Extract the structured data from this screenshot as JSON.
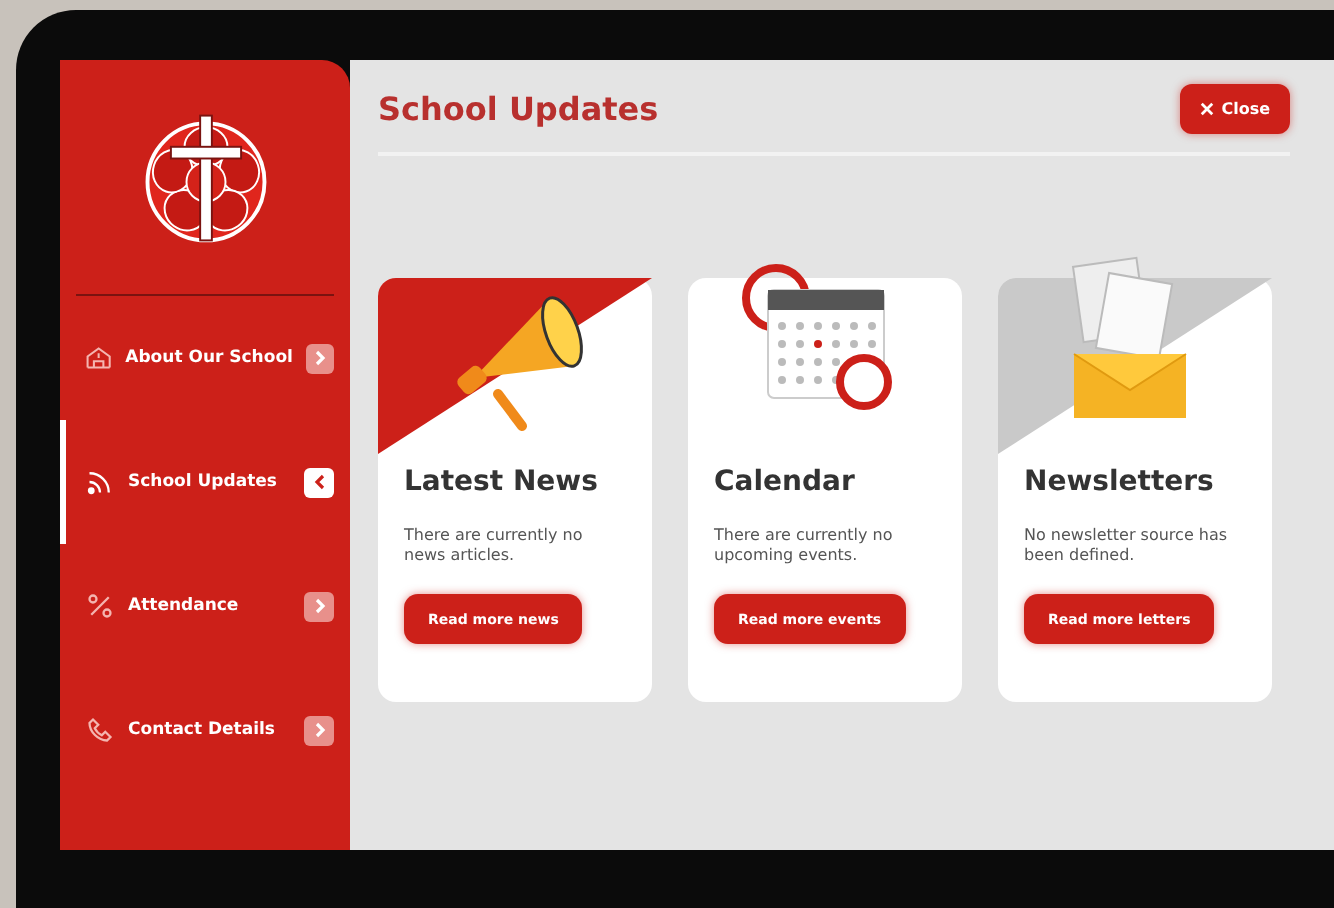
{
  "sidebar": {
    "items": [
      {
        "kind": "school",
        "label": "About Our School",
        "selected": false
      },
      {
        "kind": "feed",
        "label": "School Updates",
        "selected": true
      },
      {
        "kind": "percent",
        "label": "Attendance",
        "selected": false
      },
      {
        "kind": "phone",
        "label": "Contact Details",
        "selected": false
      }
    ]
  },
  "header": {
    "title": "School Updates",
    "close_button": "Close"
  },
  "cards": [
    {
      "kind": "megaphone",
      "title": "Latest News",
      "text": "There are currently no news articles.",
      "button": "Read more news"
    },
    {
      "kind": "calendar",
      "title": "Calendar",
      "text": "There are currently no upcoming events.",
      "button": "Read more events"
    },
    {
      "kind": "envelope",
      "title": "Newsletters",
      "text": "No newsletter source has been defined.",
      "button": "Read more letters"
    }
  ]
}
